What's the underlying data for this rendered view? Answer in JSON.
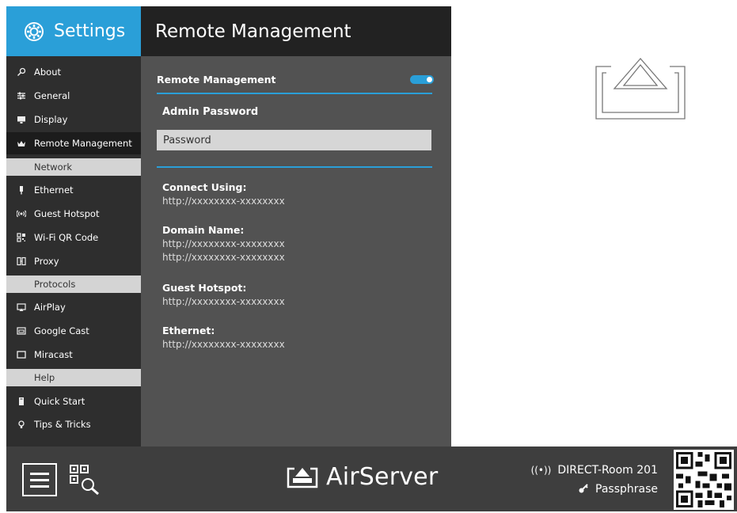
{
  "sidebar": {
    "title": "Settings",
    "items": [
      {
        "label": "About",
        "icon": "about-icon"
      },
      {
        "label": "General",
        "icon": "sliders-icon"
      },
      {
        "label": "Display",
        "icon": "display-icon"
      },
      {
        "label": "Remote Management",
        "icon": "crown-icon",
        "active": true
      },
      {
        "section": "Network"
      },
      {
        "label": "Ethernet",
        "icon": "ethernet-icon"
      },
      {
        "label": "Guest Hotspot",
        "icon": "hotspot-icon"
      },
      {
        "label": "Wi-Fi QR Code",
        "icon": "qr-icon"
      },
      {
        "label": "Proxy",
        "icon": "proxy-icon"
      },
      {
        "section": "Protocols"
      },
      {
        "label": "AirPlay",
        "icon": "airplay-icon"
      },
      {
        "label": "Google Cast",
        "icon": "cast-icon"
      },
      {
        "label": "Miracast",
        "icon": "miracast-icon"
      },
      {
        "section": "Help"
      },
      {
        "label": "Quick Start",
        "icon": "quickstart-icon"
      },
      {
        "label": "Tips & Tricks",
        "icon": "bulb-icon"
      }
    ]
  },
  "content": {
    "title": "Remote Management",
    "remote_management_label": "Remote Management",
    "remote_management_enabled": true,
    "admin_password_label": "Admin Password",
    "password_placeholder": "Password",
    "connect_label": "Connect Using:",
    "connect_value": "http://xxxxxxxx-xxxxxxxx",
    "domain_label": "Domain Name:",
    "domain_values": [
      "http://xxxxxxxx-xxxxxxxx",
      "http://xxxxxxxx-xxxxxxxx"
    ],
    "guest_label": "Guest Hotspot:",
    "guest_value": "http://xxxxxxxx-xxxxxxxx",
    "ethernet_label": "Ethernet:",
    "ethernet_value": "http://xxxxxxxx-xxxxxxxx"
  },
  "footer": {
    "brand": "AirServer",
    "network_name": "DIRECT-Room 201",
    "passphrase_label": "Passphrase"
  },
  "colors": {
    "accent": "#2a9fd8",
    "sidebar_bg": "#2e2e2e",
    "content_bg": "#525252",
    "footer_bg": "#3e3e3e"
  }
}
